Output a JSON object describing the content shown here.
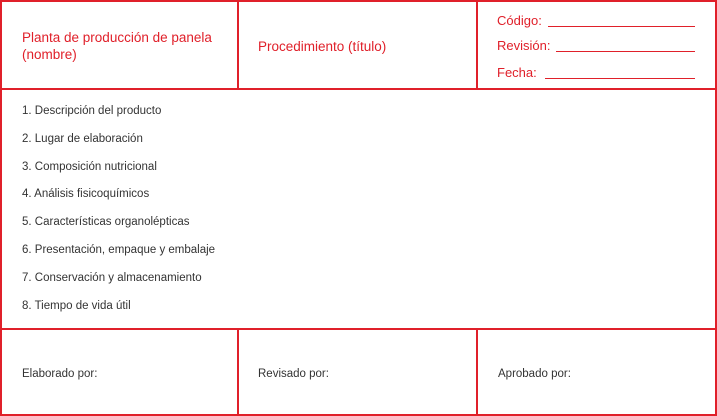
{
  "header": {
    "plant_name": "Planta de producción de panela (nombre)",
    "procedure_title": "Procedimiento (título)",
    "code_label": "Código:",
    "revision_label": "Revisión:",
    "date_label": "Fecha:"
  },
  "sections": [
    "1. Descripción del producto",
    "2. Lugar de elaboración",
    "3. Composición nutricional",
    "4. Análisis fisicoquímicos",
    "5. Características organolépticas",
    "6. Presentación, empaque y embalaje",
    "7. Conservación y almacenamiento",
    "8. Tiempo de vida útil"
  ],
  "footer": {
    "prepared_by_label": "Elaborado por:",
    "reviewed_by_label": "Revisado por:",
    "approved_by_label": "Aprobado por:"
  },
  "colors": {
    "accent": "#e0202a",
    "text": "#333333"
  }
}
